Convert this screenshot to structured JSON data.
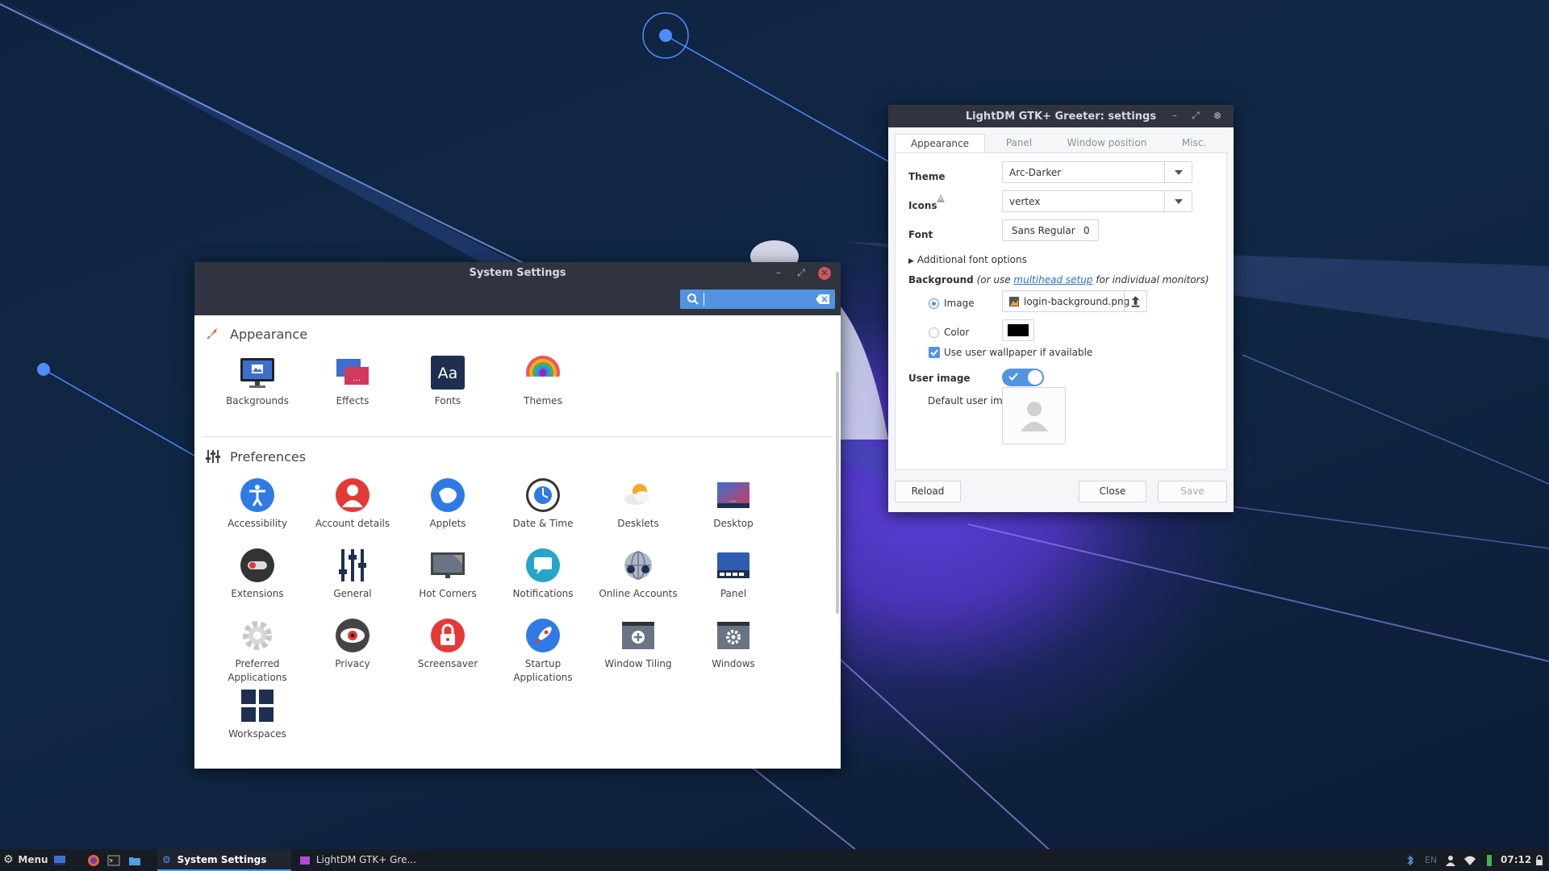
{
  "system_settings": {
    "title": "System Settings",
    "search": {
      "value": ""
    },
    "sections": [
      {
        "title": "Appearance",
        "items": [
          "Backgrounds",
          "Effects",
          "Fonts",
          "Themes"
        ]
      },
      {
        "title": "Preferences",
        "items": [
          "Accessibility",
          "Account details",
          "Applets",
          "Date & Time",
          "Desklets",
          "Desktop",
          "Extensions",
          "General",
          "Hot Corners",
          "Notifications",
          "Online Accounts",
          "Panel",
          "Preferred Applications",
          "Privacy",
          "Screensaver",
          "Startup Applications",
          "Window Tiling",
          "Windows",
          "Workspaces"
        ]
      }
    ],
    "fonts_icon_text": "Aa"
  },
  "lightdm": {
    "title": "LightDM GTK+ Greeter: settings",
    "tabs": [
      "Appearance",
      "Panel",
      "Window position",
      "Misc."
    ],
    "theme_label": "Theme",
    "theme_value": "Arc-Darker",
    "icons_label": "Icons",
    "icons_value": "vertex",
    "font_label": "Font",
    "font_value": "Sans Regular",
    "font_size": "0",
    "additional_font": "Additional font options",
    "background_label": "Background",
    "background_note_pre": "(or use ",
    "background_link": "multihead setup",
    "background_note_post": " for individual monitors)",
    "image_label": "Image",
    "image_file": "login-background.png",
    "color_label": "Color",
    "color_value": "#000000",
    "use_wallpaper": "Use user wallpaper if available",
    "user_image_label": "User image",
    "default_user_image": "Default user image",
    "reload": "Reload",
    "close": "Close",
    "save": "Save"
  },
  "taskbar": {
    "menu": "Menu",
    "tasks": [
      "System Settings",
      "LightDM GTK+ Gre..."
    ],
    "language": "EN",
    "clock": "07:12"
  },
  "colors": {
    "accent": "#5294e2",
    "titlebar": "#2f343f",
    "close": "#cc575d",
    "taskbar": "#171b24"
  }
}
